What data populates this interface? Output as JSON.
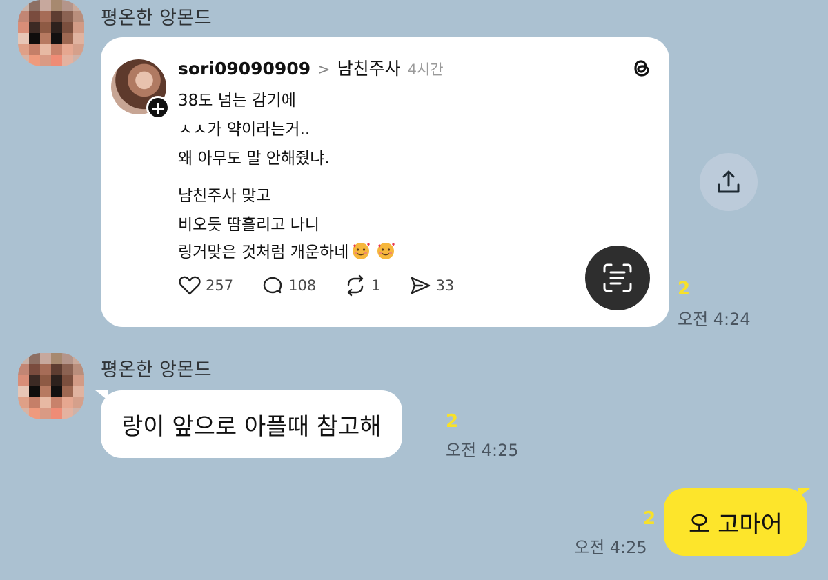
{
  "colors": {
    "chat_background": "#abc1d1",
    "incoming_bubble": "#ffffff",
    "outgoing_bubble": "#fde52b",
    "unread_count": "#f7e12a"
  },
  "messages": [
    {
      "sender": "평온한 앙몬드",
      "type": "shared-post",
      "post": {
        "username": "sori09090909",
        "topic": "남친주사",
        "time": "4시간",
        "lines": [
          "38도 넘는 감기에",
          "ㅅㅅ가 약이라는거..",
          "왜 아무도 말 안해줬냐.",
          "남친주사 맞고",
          "비오듯 땀흘리고 나니",
          "링거맞은 것처럼 개운하네"
        ],
        "emoji": "smiling-face-with-hearts",
        "likes": "257",
        "replies": "108",
        "reposts": "1",
        "shares": "33",
        "icons": [
          "threads-logo-icon",
          "heart-icon",
          "comment-icon",
          "repost-icon",
          "send-icon"
        ]
      },
      "unread": "2",
      "time": "오전 4:24"
    },
    {
      "sender": "평온한 앙몬드",
      "type": "text",
      "text": "랑이 앞으로 아플때 참고해",
      "unread": "2",
      "time": "오전 4:25"
    },
    {
      "sender": "me",
      "type": "text",
      "text": "오 고마어",
      "unread": "2",
      "time": "오전 4:25"
    }
  ],
  "actions": {
    "share_icon": "share-upload-icon",
    "scan_icon": "text-scan-icon"
  }
}
